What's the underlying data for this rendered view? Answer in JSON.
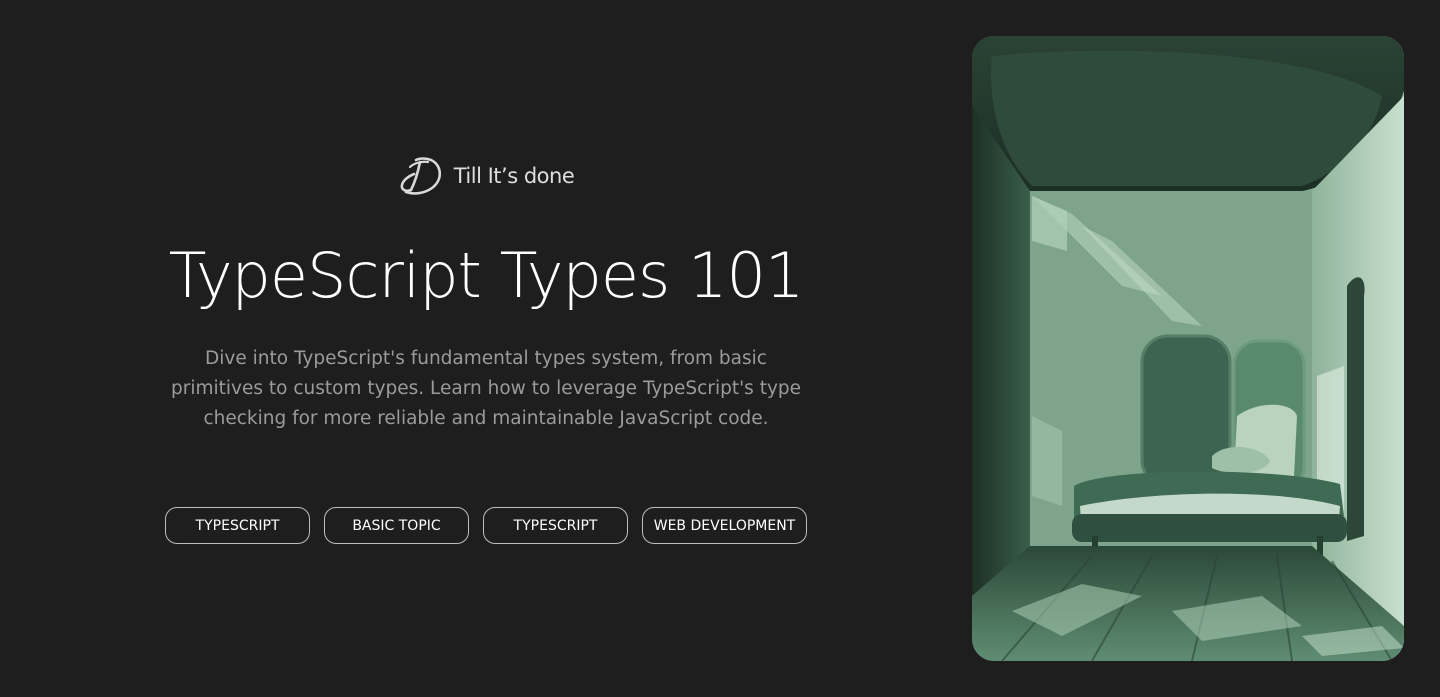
{
  "brand": {
    "name": "Till It’s done",
    "logo_icon": "signature-d-logo-icon"
  },
  "hero": {
    "title": "TypeScript Types 101",
    "description": "Dive into TypeScript's fundamental types system, from basic primitives to custom types. Learn how to leverage TypeScript's type checking for more reliable and maintainable JavaScript code."
  },
  "tags": [
    "TYPESCRIPT",
    "BASIC TOPIC",
    "TYPESCRIPT",
    "WEB DEVELOPMENT"
  ],
  "colors": {
    "background": "#1e1e1e",
    "title": "#ffffff",
    "description": "#9b9b9b",
    "tag_border": "#bdbdbd",
    "art_green": "#3f6b53"
  }
}
